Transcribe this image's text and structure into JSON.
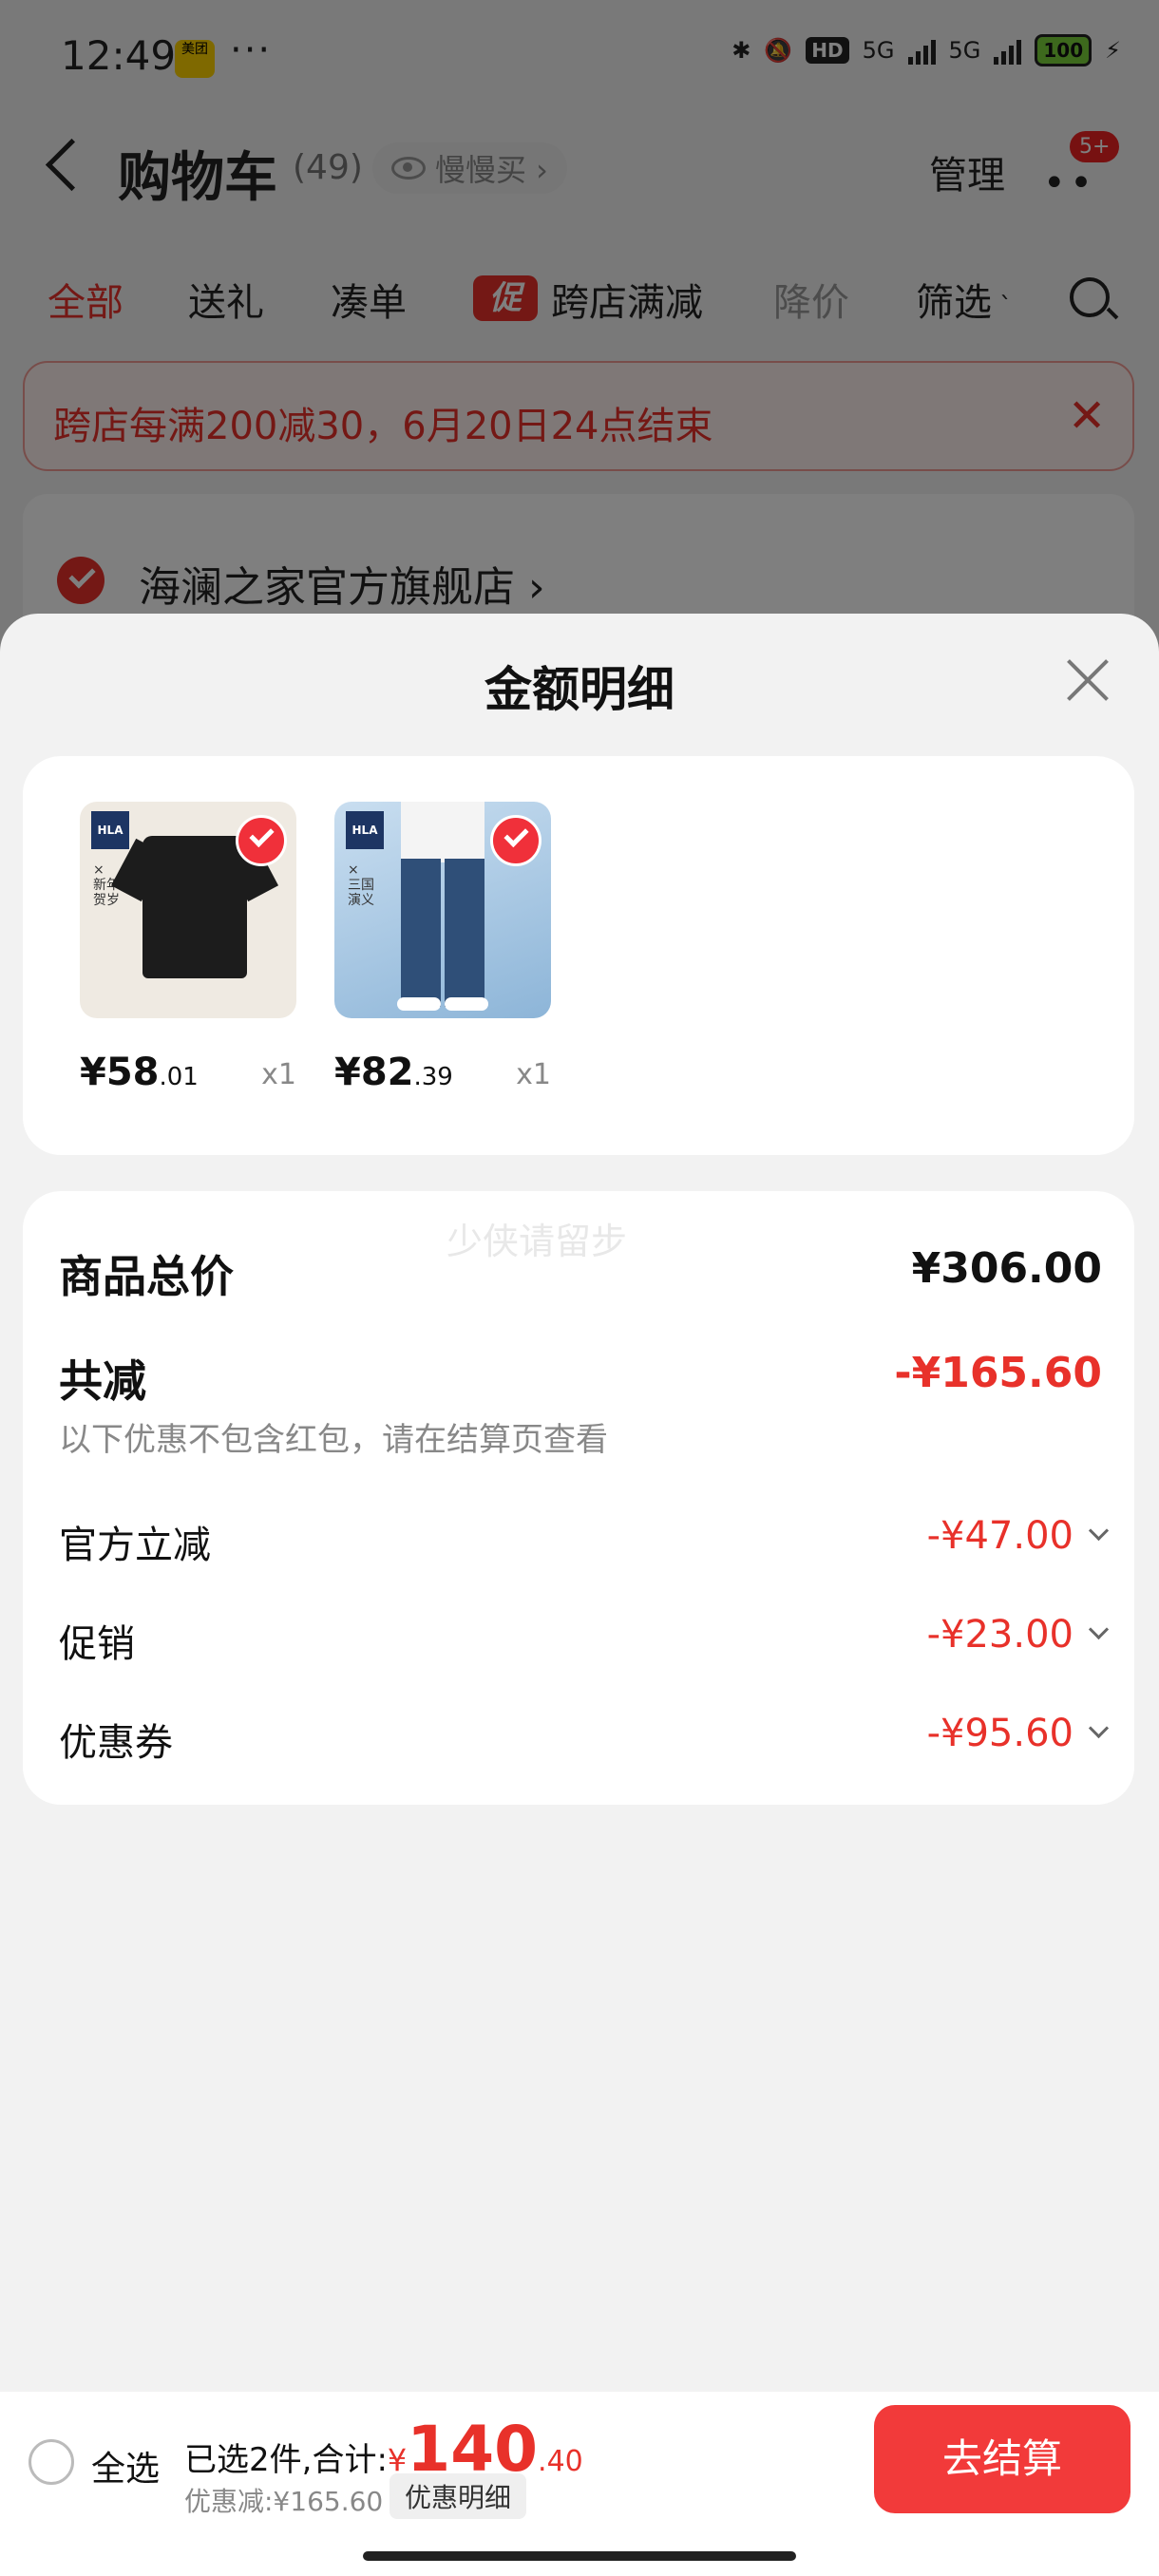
{
  "status_bar": {
    "time": "12:49",
    "app_badge": "美团",
    "dots": "···",
    "hd": "HD",
    "net1": "5G",
    "net2": "5G",
    "battery": "100"
  },
  "nav": {
    "title": "购物车",
    "count": "(49)",
    "slow_buy": "慢慢买 ›",
    "manage": "管理",
    "msg_badge": "5+"
  },
  "filter_tabs": {
    "all": "全部",
    "gift": "送礼",
    "bundle": "凑单",
    "promo_tag": "促",
    "cross_store": "跨店满减",
    "price_drop": "降价",
    "filter": "筛选"
  },
  "notice": {
    "text": "跨店每满200减30，6月20日24点结束"
  },
  "store": {
    "name": "海澜之家官方旗舰店 ›"
  },
  "sheet": {
    "title": "金额明细",
    "items": [
      {
        "price_int": "¥58",
        "price_dec": ".01",
        "qty": "x1",
        "thumb_icon": "black-polo-shirt"
      },
      {
        "price_int": "¥82",
        "price_dec": ".39",
        "qty": "x1",
        "thumb_icon": "blue-jeans"
      }
    ],
    "watermark": "少侠请留步",
    "total_label": "商品总价",
    "total_value": "¥306.00",
    "reduce_label": "共减",
    "reduce_value": "-¥165.60",
    "note": "以下优惠不包含红包，请在结算页查看",
    "details": [
      {
        "label": "官方立减",
        "value": "-¥47.00"
      },
      {
        "label": "促销",
        "value": "-¥23.00"
      },
      {
        "label": "优惠券",
        "value": "-¥95.60"
      }
    ]
  },
  "bottom_bar": {
    "select_all": "全选",
    "selected_summary": "已选2件,合计:",
    "currency": "¥",
    "total_int": "140",
    "total_dec": ".40",
    "discount": "优惠减:¥165.60",
    "detail_chip": "优惠明细",
    "checkout": "去结算"
  },
  "colors": {
    "accent": "#e8312a",
    "checkout": "#f23a3a"
  }
}
